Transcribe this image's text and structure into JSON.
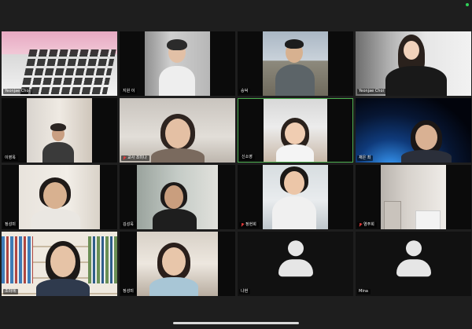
{
  "participants": [
    {
      "name": "Yeonjae Choi",
      "muted": false
    },
    {
      "name": "지원 이",
      "muted": false
    },
    {
      "name": "승덕",
      "muted": false
    },
    {
      "name": "Yeonjae Choi",
      "muted": false
    },
    {
      "name": "이영옥",
      "muted": false
    },
    {
      "name": "교사 조미나",
      "muted": true
    },
    {
      "name": "신소영",
      "muted": false
    },
    {
      "name": "채은 최",
      "muted": false
    },
    {
      "name": "정성미",
      "muted": false
    },
    {
      "name": "김성욱",
      "muted": false
    },
    {
      "name": "정현희",
      "muted": true
    },
    {
      "name": "염주희",
      "muted": true
    },
    {
      "name": "조미애",
      "muted": false
    },
    {
      "name": "정성미",
      "muted": false
    },
    {
      "name": "나현",
      "muted": false
    },
    {
      "name": "Mina",
      "muted": false
    }
  ],
  "active_speaker_index": 6,
  "colors": {
    "background": "#1e1e1e",
    "active_border": "#4cb050",
    "status_dot": "#2fd158",
    "muted_mic": "#e23b3b"
  },
  "icons": [
    "mic-muted-icon",
    "avatar-icon"
  ]
}
